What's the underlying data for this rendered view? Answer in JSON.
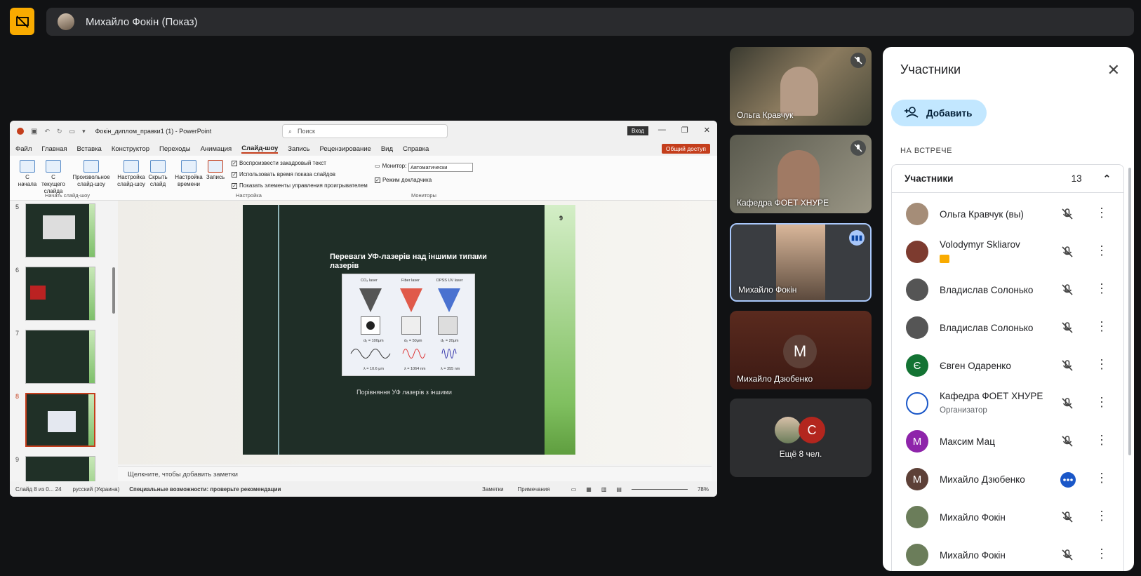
{
  "header": {
    "presenter_title": "Михайло Фокін (Показ)"
  },
  "powerpoint": {
    "title": "Фокін_диплом_правки1 (1)  -  PowerPoint",
    "search_placeholder": "Поиск",
    "login_label": "Вход",
    "share_label": "Общий доступ",
    "menu": [
      "Файл",
      "Главная",
      "Вставка",
      "Конструктор",
      "Переходы",
      "Анимация",
      "Слайд-шоу",
      "Запись",
      "Рецензирование",
      "Вид",
      "Справка"
    ],
    "ribbon": {
      "from_start": "С начала",
      "from_current": "С текущего слайда",
      "custom_show": "Произвольное слайд-шоу",
      "setup_show": "Настройка слайд-шоу",
      "hide_slide": "Скрыть слайд",
      "rehearse": "Настройка времени",
      "record": "Запись",
      "check_narration": "Воспроизвести закадровый текст",
      "check_timings": "Использовать время показа слайдов",
      "check_media": "Показать элементы управления проигрывателем",
      "monitor_label": "Монитор:",
      "monitor_value": "Автоматически",
      "presenter_view": "Режим докладчика",
      "group_start": "Начать слайд-шоу",
      "group_setup": "Настройка",
      "group_monitors": "Мониторы"
    },
    "thumbnails": [
      "5",
      "6",
      "7",
      "8",
      "9"
    ],
    "slide": {
      "number": "9",
      "title": "Переваги УФ-лазерів над іншими типами лазерів",
      "labels": [
        "CO₂ laser",
        "Fiber laser",
        "DPSS UV laser"
      ],
      "spot_labels": [
        "d₀ = 100μm",
        "d₀ = 50μm",
        "d₀ = 20μm"
      ],
      "wave_labels": [
        "λ = 10.6 μm",
        "λ = 1064 nm",
        "λ = 355 nm"
      ],
      "caption": "Порівняння УФ лазерів з іншими"
    },
    "notes_placeholder": "Щелкните, чтобы добавить заметки",
    "status": {
      "slide_info": "Слайд 8 из 0... 24",
      "language": "русский (Украина)",
      "accessibility": "Специальные возможности: проверьте рекомендации",
      "notes": "Заметки",
      "comments": "Примечания",
      "zoom": "78%"
    }
  },
  "tiles": [
    {
      "name": "Ольга Кравчук"
    },
    {
      "name": "Кафедра ФОЕТ ХНУРЕ"
    },
    {
      "name": "Михайло Фокін"
    },
    {
      "name": "Михайло Дзюбенко",
      "initial": "M"
    },
    {
      "name": "Ещё 8 чел.",
      "initial": "C"
    }
  ],
  "panel": {
    "title": "Участники",
    "add_label": "Добавить",
    "section": "НА ВСТРЕЧЕ",
    "group_label": "Участники",
    "count": "13",
    "participants": [
      {
        "name": "Ольга Кравчук (вы)",
        "color": "#a58d78"
      },
      {
        "name": "Volodymyr Skliarov",
        "color": "#7d3b2f"
      },
      {
        "name": "Владислав Солонько",
        "color": "#555"
      },
      {
        "name": "Владислав Солонько",
        "color": "#555"
      },
      {
        "name": "Євген Одаренко",
        "initial": "Є",
        "color": "#137333"
      },
      {
        "name": "Кафедра ФОЕТ ХНУРЕ",
        "sub": "Организатор",
        "color": "#fff"
      },
      {
        "name": "Максим Мац",
        "initial": "M",
        "color": "#8e24aa"
      },
      {
        "name": "Михайло Дзюбенко",
        "initial": "M",
        "color": "#5d4037"
      },
      {
        "name": "Михайло Фокін",
        "color": "#6b7d5a"
      },
      {
        "name": "Михайло Фокін",
        "color": "#6b7d5a"
      }
    ]
  }
}
